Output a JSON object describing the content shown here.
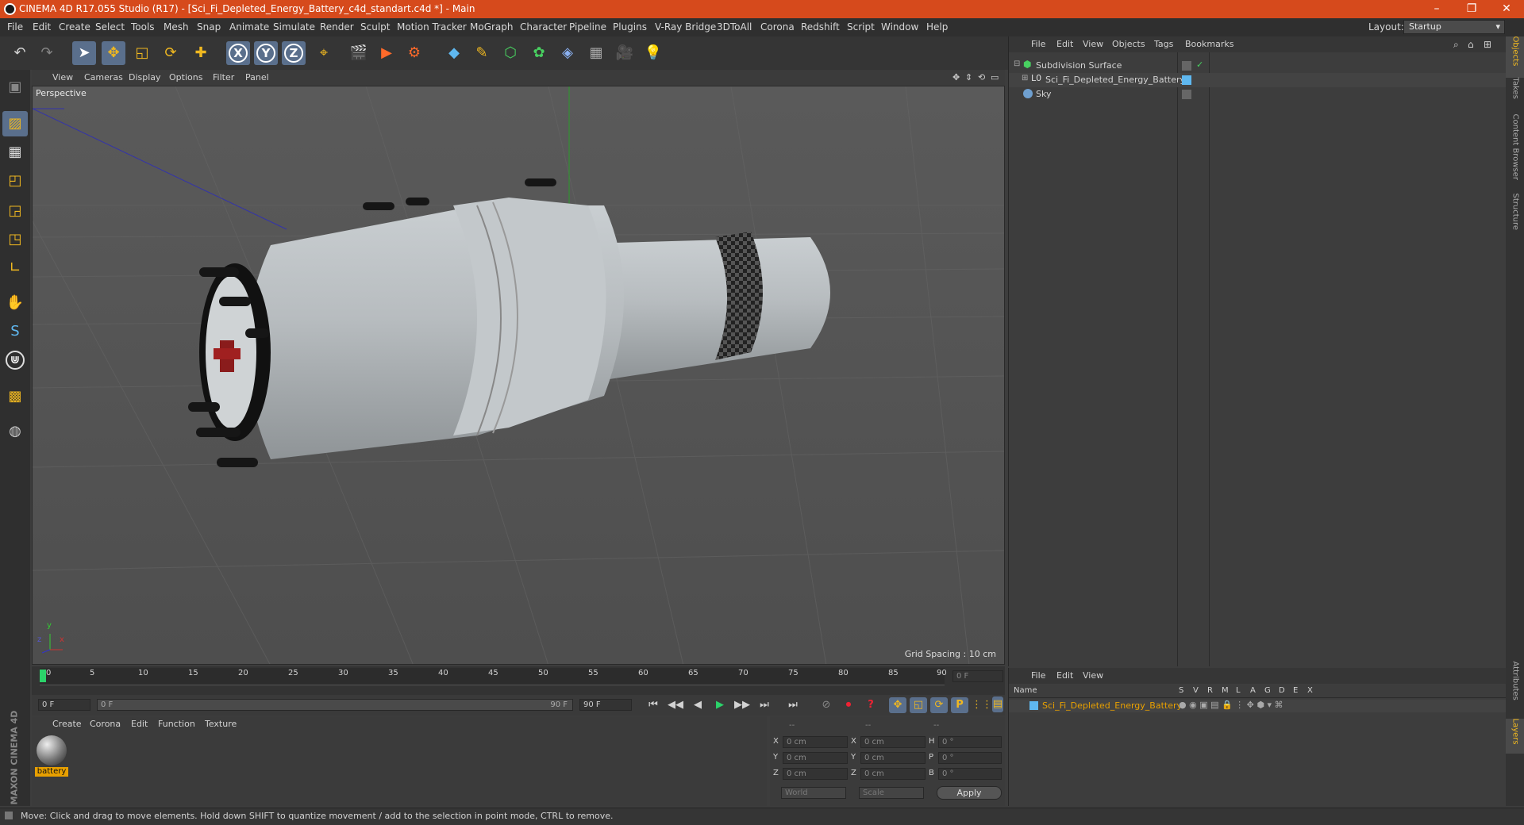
{
  "title": "CINEMA 4D R17.055 Studio (R17) - [Sci_Fi_Depleted_Energy_Battery_c4d_standart.c4d *] - Main",
  "window_controls": {
    "minimize": "–",
    "maximize": "❐",
    "close": "✕"
  },
  "menu": [
    "File",
    "Edit",
    "Create",
    "Select",
    "Tools",
    "Mesh",
    "Snap",
    "Animate",
    "Simulate",
    "Render",
    "Sculpt",
    "Motion Tracker",
    "MoGraph",
    "Character",
    "Pipeline",
    "Plugins",
    "V-Ray Bridge",
    "3DToAll",
    "Corona",
    "Redshift",
    "Script",
    "Window",
    "Help"
  ],
  "layout": {
    "label": "Layout:",
    "value": "Startup"
  },
  "toolbar": {
    "undo": "↶",
    "redo": "↷",
    "select": "➤",
    "move": "✥",
    "scale": "◱",
    "rotate": "⟳",
    "add": "✚",
    "x": "X",
    "y": "Y",
    "z": "Z",
    "coord": "⌖",
    "render_view": "🎬",
    "render": "▶",
    "render_settings": "⚙",
    "cube": "◆",
    "pen": "✎",
    "subdiv": "⬡",
    "mograph": "✿",
    "deformer": "◈",
    "floor": "▦",
    "camera": "🎥",
    "light": "💡"
  },
  "left_tools": [
    "▣",
    "▨",
    "▦",
    "◰",
    "◲",
    "◳",
    "∟",
    "✋",
    "S",
    "⋓",
    "▩",
    "◍"
  ],
  "viewport": {
    "menu": [
      "View",
      "Cameras",
      "Display",
      "Options",
      "Filter",
      "Panel"
    ],
    "label": "Perspective",
    "grid_spacing": "Grid Spacing : 10 cm",
    "nav": [
      "✥",
      "⇕",
      "⟲",
      "▭"
    ],
    "axis": {
      "y": "y",
      "x": "x",
      "z": "z"
    }
  },
  "timeline": {
    "ticks": [
      "0",
      "5",
      "10",
      "15",
      "20",
      "25",
      "30",
      "35",
      "40",
      "45",
      "50",
      "55",
      "60",
      "65",
      "70",
      "75",
      "80",
      "85",
      "90"
    ],
    "current": "0 F",
    "end_field": "0 F"
  },
  "transport": {
    "start": "0 F",
    "range_start": "0 F",
    "range_end": "90 F",
    "end": "90 F",
    "buttons": [
      "⏮",
      "◀◀",
      "◀",
      "▶",
      "▶▶",
      "⏭",
      "⏭"
    ],
    "keys": [
      "⊘",
      "⏺",
      "?",
      "✥",
      "◱",
      "⟳",
      "P",
      "⋮⋮",
      "▤"
    ]
  },
  "material": {
    "menu": [
      "Create",
      "Corona",
      "Edit",
      "Function",
      "Texture"
    ],
    "items": [
      {
        "name": "battery"
      }
    ]
  },
  "coords": {
    "headers": [
      "--",
      "--",
      "--"
    ],
    "rows": [
      {
        "a": "X",
        "av": "0 cm",
        "b": "X",
        "bv": "0 cm",
        "c": "H",
        "cv": "0 °"
      },
      {
        "a": "Y",
        "av": "0 cm",
        "b": "Y",
        "bv": "0 cm",
        "c": "P",
        "cv": "0 °"
      },
      {
        "a": "Z",
        "av": "0 cm",
        "b": "Z",
        "bv": "0 cm",
        "c": "B",
        "cv": "0 °"
      }
    ],
    "mode1": "World",
    "mode2": "Scale",
    "apply": "Apply"
  },
  "objects": {
    "menu": [
      "File",
      "Edit",
      "View",
      "Objects",
      "Tags",
      "Bookmarks"
    ],
    "items": [
      {
        "name": "Subdivision Surface",
        "check": "✓"
      },
      {
        "name": "Sci_Fi_Depleted_Energy_Battery",
        "check": ""
      },
      {
        "name": "Sky",
        "check": ""
      }
    ]
  },
  "layers": {
    "menu": [
      "File",
      "Edit",
      "View"
    ],
    "cols": [
      "Name",
      "S",
      "V",
      "R",
      "M",
      "L",
      "A",
      "G",
      "D",
      "E",
      "X"
    ],
    "items": [
      {
        "name": "Sci_Fi_Depleted_Energy_Battery"
      }
    ]
  },
  "right_tabs": [
    "Objects",
    "Takes",
    "Content Browser",
    "Structure",
    "Attributes",
    "Layers"
  ],
  "brand": "MAXON CINEMA 4D",
  "status": "Move: Click and drag to move elements. Hold down SHIFT to quantize movement / add to the selection in point mode, CTRL to remove.",
  "colors": {
    "accent": "#d64a1c",
    "selected_layer": "#e8a000"
  }
}
